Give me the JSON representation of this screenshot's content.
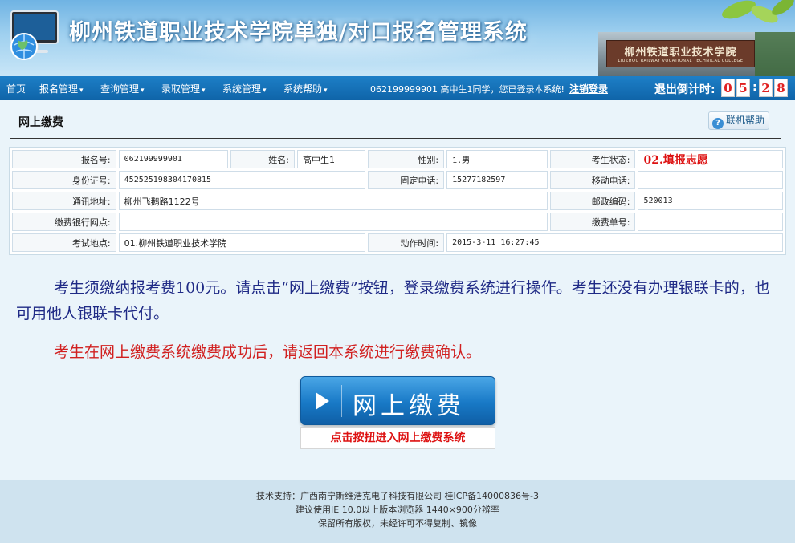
{
  "header": {
    "title": "柳州铁道职业技术学院单独/对口报名管理系统",
    "campus_sign_cn": "柳州铁道职业技术学院",
    "campus_sign_en": "LIUZHOU RAILWAY VOCATIONAL TECHNICAL COLLEGE"
  },
  "nav": {
    "items": [
      {
        "label": "首页",
        "caret": ""
      },
      {
        "label": "报名管理",
        "caret": "▾"
      },
      {
        "label": "查询管理",
        "caret": "▾"
      },
      {
        "label": "录取管理",
        "caret": "▾"
      },
      {
        "label": "系统管理",
        "caret": "▾"
      },
      {
        "label": "系统帮助",
        "caret": "▾"
      }
    ],
    "welcome": "062199999901 高中生1同学，您已登录本系统!",
    "logout": "注销登录",
    "countdown_label": "退出倒计时:",
    "countdown": [
      "0",
      "5",
      "2",
      "8"
    ],
    "countdown_sep": ":"
  },
  "page": {
    "title": "网上缴费",
    "help_label": "联机帮助",
    "help_icon": "?"
  },
  "info": {
    "labels": {
      "reg_no": "报名号:",
      "name": "姓名:",
      "gender": "性别:",
      "status": "考生状态:",
      "id_no": "身份证号:",
      "phone": "固定电话:",
      "mobile": "移动电话:",
      "address": "通讯地址:",
      "postcode": "邮政编码:",
      "bank": "缴费银行网点:",
      "pay_no": "缴费单号:",
      "exam_site": "考试地点:",
      "action_time": "动作时间:"
    },
    "values": {
      "reg_no": "062199999901",
      "name": "高中生1",
      "gender": "1.男",
      "status": "02.填报志愿",
      "id_no": "452525198304170815",
      "phone": "15277182597",
      "mobile": "",
      "address": "柳州飞鹅路1122号",
      "postcode": "520013",
      "bank": "",
      "pay_no": "",
      "exam_site": "01.柳州铁道职业技术学院",
      "action_time": "2015-3-11 16:27:45"
    }
  },
  "notice": {
    "line1": "考生须缴纳报考费100元。请点击“网上缴费”按钮，登录缴费系统进行操作。考生还没有办理银联卡的，也可用他人银联卡代付。",
    "line2": "考生在网上缴费系统缴费成功后，请返回本系统进行缴费确认。"
  },
  "pay": {
    "button_label": "网上缴费",
    "sub_label": "点击按扭进入网上缴费系统"
  },
  "footer": {
    "line1": "技术支持：广西南宁斯维浩克电子科技有限公司    桂ICP备14000836号-3",
    "line2": "建议使用IE 10.0以上版本浏览器 1440×900分辨率",
    "line3": "保留所有版权，未经许可不得复制、镜像"
  },
  "colors": {
    "nav": "#0f64a8",
    "notice_blue": "#1f2a86",
    "notice_red": "#d12020",
    "status_red": "#dd1111"
  }
}
